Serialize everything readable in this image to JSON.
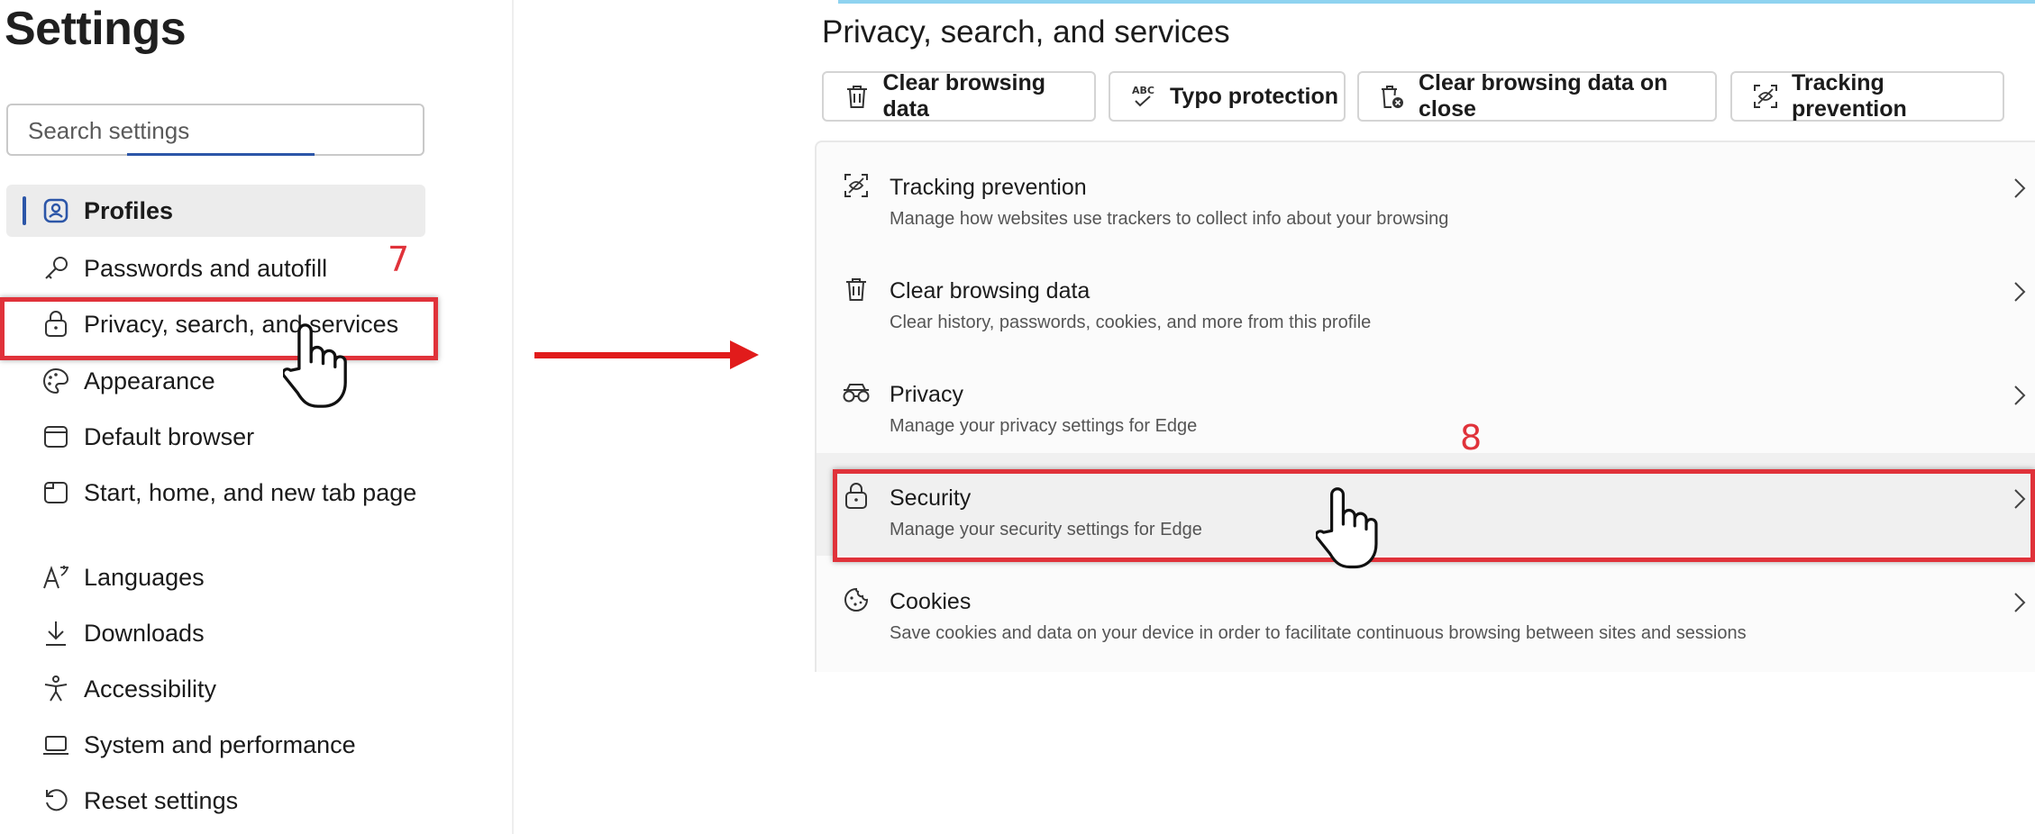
{
  "sidebar": {
    "title": "Settings",
    "search_placeholder": "Search settings",
    "items": [
      {
        "label": "Profiles",
        "icon": "profile-icon"
      },
      {
        "label": "Passwords and autofill",
        "icon": "key-icon"
      },
      {
        "label": "Privacy, search, and services",
        "icon": "lock-icon"
      },
      {
        "label": "Appearance",
        "icon": "palette-icon"
      },
      {
        "label": "Default browser",
        "icon": "browser-icon"
      },
      {
        "label": "Start, home, and new tab page",
        "icon": "home-tab-icon"
      },
      {
        "label": "Languages",
        "icon": "languages-icon"
      },
      {
        "label": "Downloads",
        "icon": "download-icon"
      },
      {
        "label": "Accessibility",
        "icon": "accessibility-icon"
      },
      {
        "label": "System and performance",
        "icon": "laptop-icon"
      },
      {
        "label": "Reset settings",
        "icon": "reset-icon"
      }
    ]
  },
  "annotations": {
    "step_7": "7",
    "step_8": "8",
    "highlight_color": "#e0323a",
    "arrow_color": "#e11b1b"
  },
  "main": {
    "title": "Privacy, search, and services",
    "quick_buttons": [
      {
        "label": "Clear browsing data",
        "icon": "trash-icon"
      },
      {
        "label": "Typo protection",
        "icon": "spellcheck-icon"
      },
      {
        "label": "Clear browsing data on close",
        "icon": "trash-clock-icon"
      },
      {
        "label": "Tracking prevention",
        "icon": "tracking-icon"
      }
    ],
    "rows": [
      {
        "title": "Tracking prevention",
        "desc": "Manage how websites use trackers to collect info about your browsing",
        "icon": "tracking-icon"
      },
      {
        "title": "Clear browsing data",
        "desc": "Clear history, passwords, cookies, and more from this profile",
        "icon": "trash-icon"
      },
      {
        "title": "Privacy",
        "desc": "Manage your privacy settings for Edge",
        "icon": "glasses-icon"
      },
      {
        "title": "Security",
        "desc": "Manage your security settings for Edge",
        "icon": "lock-icon"
      },
      {
        "title": "Cookies",
        "desc": "Save cookies and data on your device in order to facilitate continuous browsing between sites and sessions",
        "icon": "cookie-icon"
      }
    ]
  },
  "colors": {
    "accent": "#2c56a8",
    "top_accent": "#8fd3f0"
  }
}
